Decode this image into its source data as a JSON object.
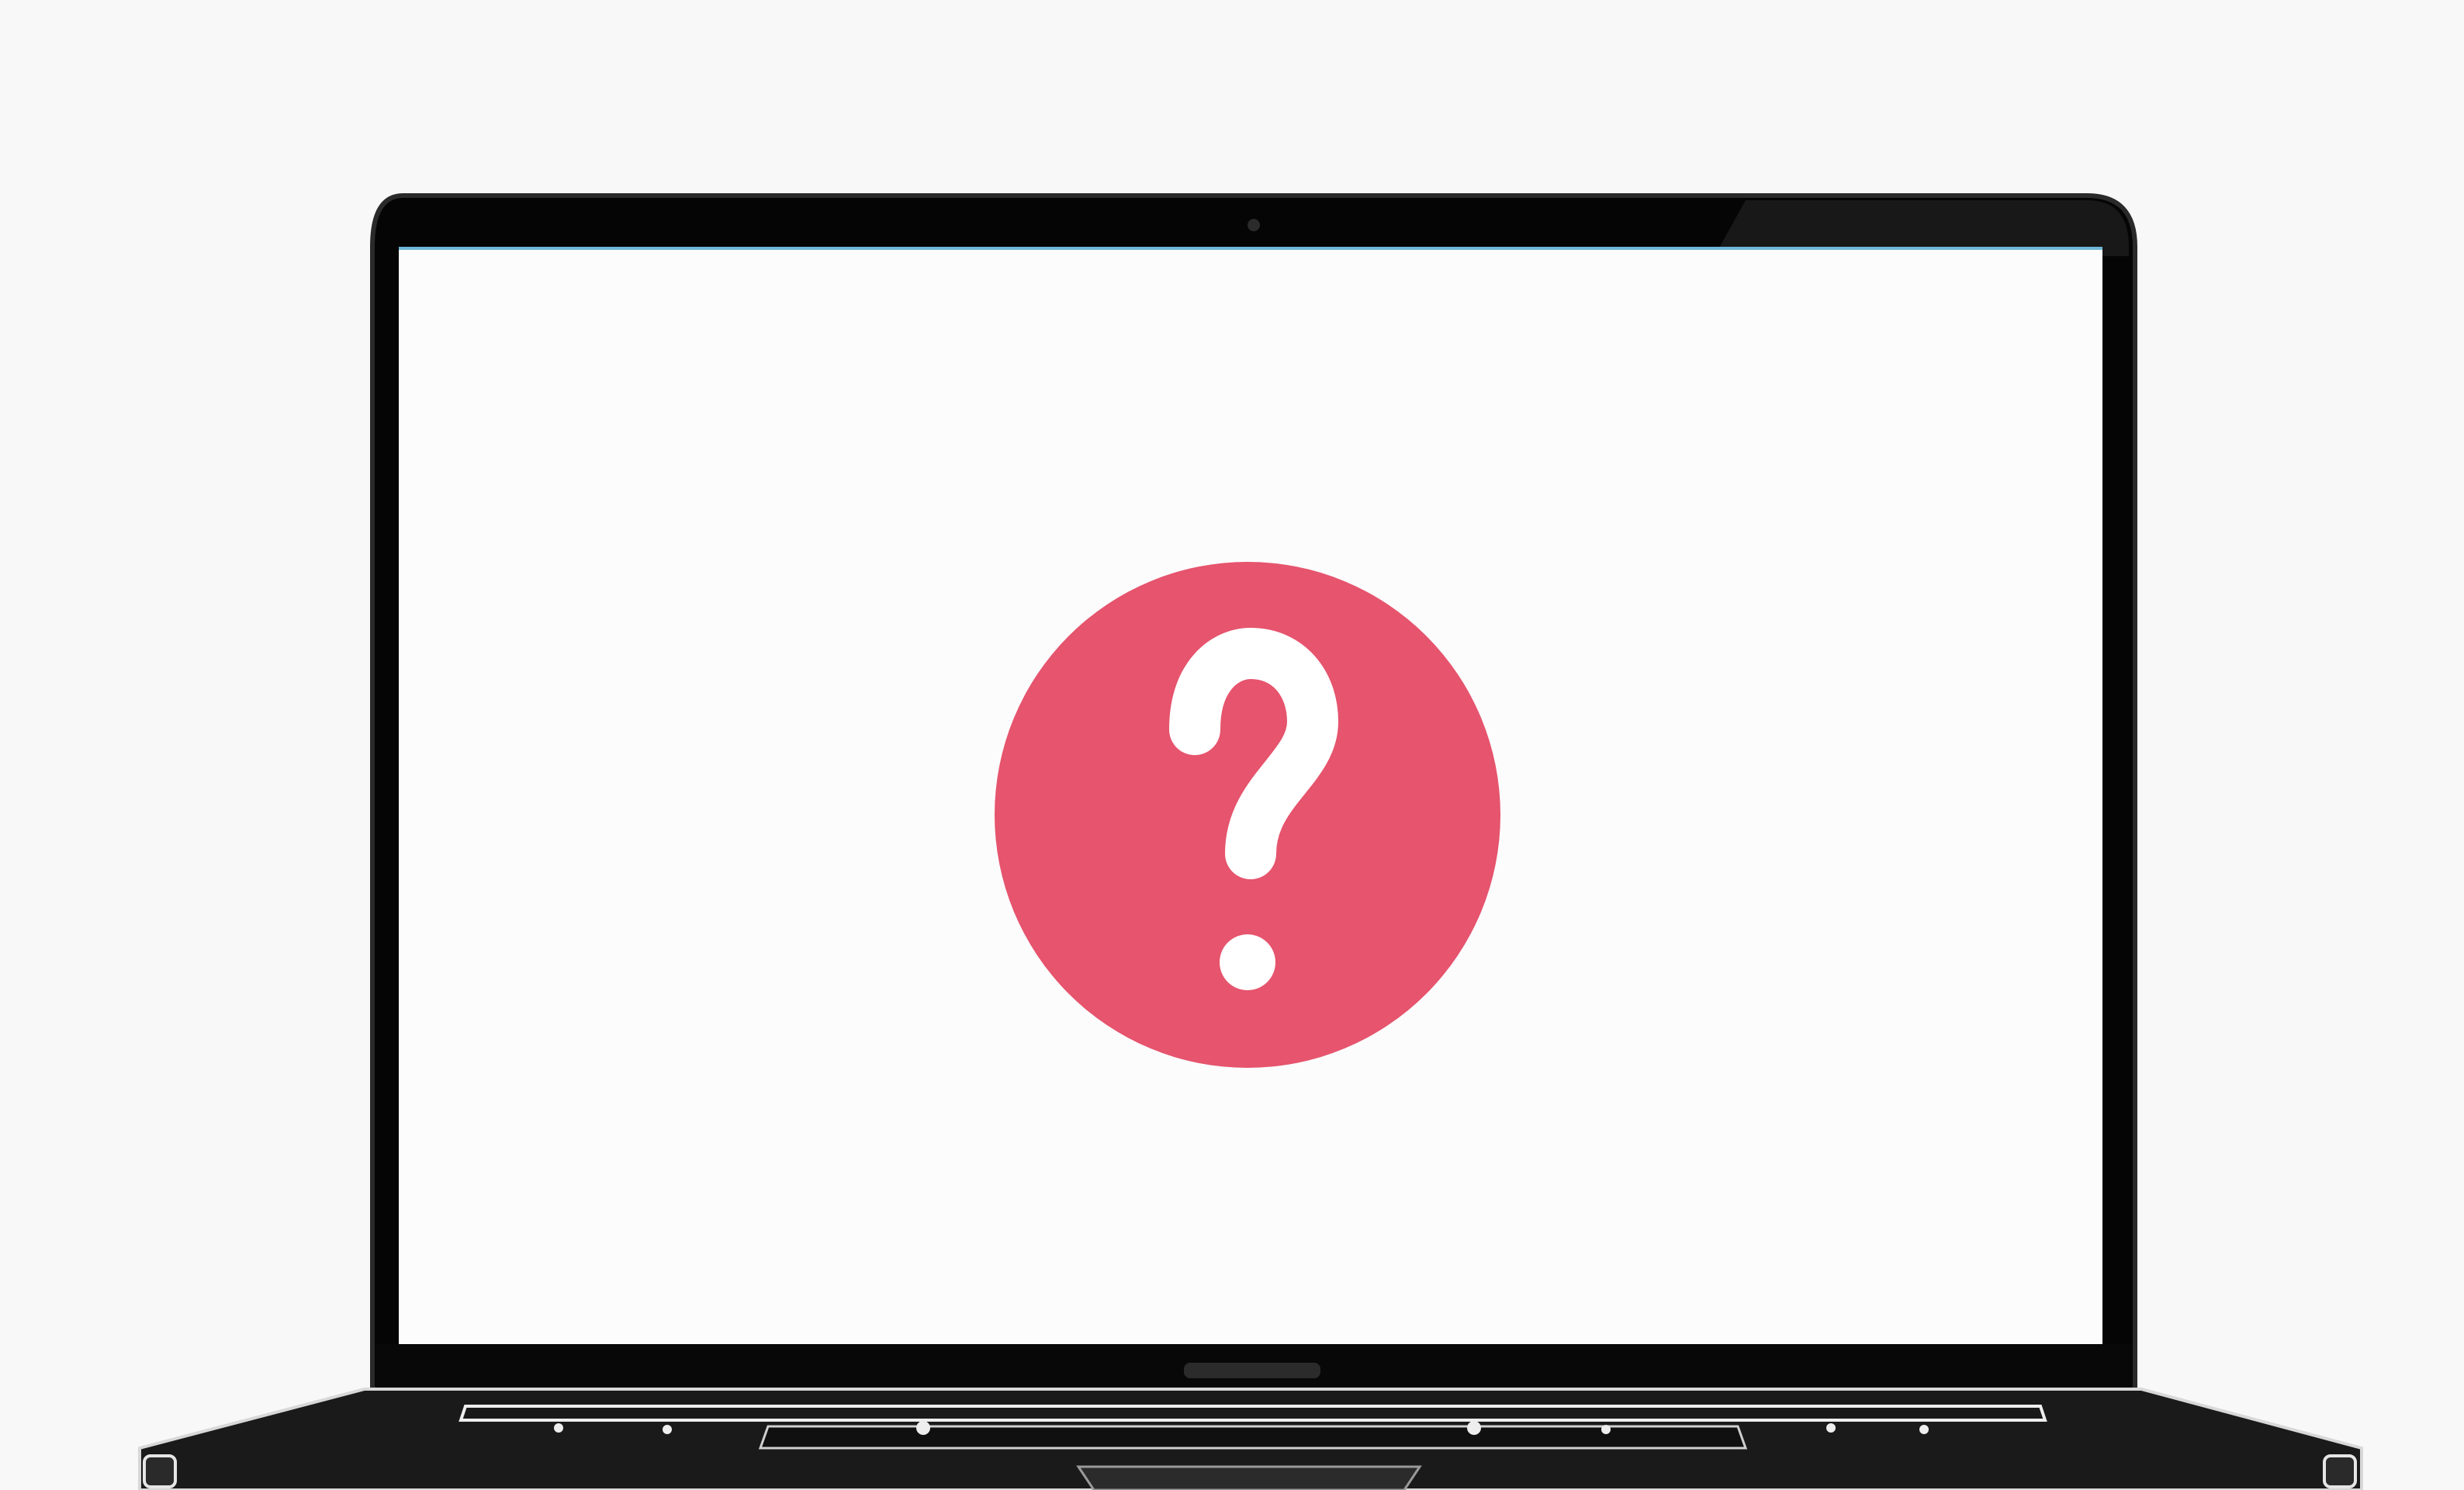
{
  "scene": {
    "background_color": "#f8f8f9",
    "device": "laptop",
    "screen_color": "#fcfcfd",
    "bezel_color": "#050505",
    "base_color": "#1a1a1a"
  },
  "status_icon": {
    "icon": "question-mark-icon",
    "circle_color": "#e6546d",
    "glyph_color": "#ffffff"
  }
}
